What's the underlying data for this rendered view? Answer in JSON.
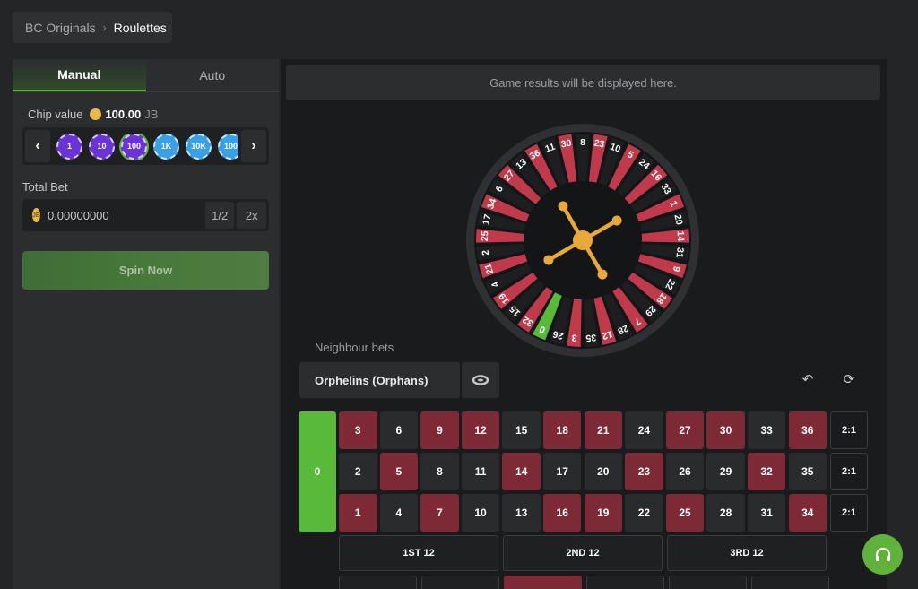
{
  "breadcrumb": {
    "parent": "BC Originals",
    "separator": "›",
    "current": "Roulettes"
  },
  "tabs": {
    "manual": "Manual",
    "auto": "Auto"
  },
  "chip_value": {
    "label": "Chip value",
    "amount": "100.00",
    "unit": "JB"
  },
  "chips": [
    "1",
    "10",
    "100",
    "1K",
    "10K",
    "100"
  ],
  "total_bet": {
    "label": "Total Bet",
    "coin": "JB",
    "value": "0.00000000",
    "half": "1/2",
    "double": "2x"
  },
  "spin_label": "Spin Now",
  "results_placeholder": "Game results will be displayed here.",
  "neighbour": {
    "label": "Neighbour bets",
    "selected": "Orphelins (Orphans)"
  },
  "wheel": {
    "sequence": [
      "0",
      "32",
      "15",
      "19",
      "4",
      "21",
      "2",
      "25",
      "17",
      "34",
      "6",
      "27",
      "13",
      "36",
      "11",
      "30",
      "8",
      "23",
      "10",
      "5",
      "24",
      "16",
      "33",
      "1",
      "20",
      "14",
      "31",
      "9",
      "22",
      "18",
      "29",
      "7",
      "28",
      "12",
      "35",
      "3",
      "26"
    ],
    "reds": [
      "1",
      "3",
      "5",
      "7",
      "9",
      "12",
      "14",
      "16",
      "18",
      "19",
      "21",
      "23",
      "25",
      "27",
      "30",
      "32",
      "34",
      "36"
    ]
  },
  "board": {
    "zero": "0",
    "rows": [
      [
        "3",
        "6",
        "9",
        "12",
        "15",
        "18",
        "21",
        "24",
        "27",
        "30",
        "33",
        "36"
      ],
      [
        "2",
        "5",
        "8",
        "11",
        "14",
        "17",
        "20",
        "23",
        "26",
        "29",
        "32",
        "35"
      ],
      [
        "1",
        "4",
        "7",
        "10",
        "13",
        "16",
        "19",
        "22",
        "25",
        "28",
        "31",
        "34"
      ]
    ],
    "columns": [
      "2:1",
      "2:1",
      "2:1"
    ],
    "dozens": [
      "1ST 12",
      "2ND 12",
      "3RD 12"
    ]
  },
  "colors": {
    "accent": "#5fb33a",
    "red": "#7e2a36",
    "black": "#2a2b2d",
    "wheel_red": "#c13a4b",
    "wheel_black": "#1d1e20",
    "gold": "#e8a83a"
  }
}
